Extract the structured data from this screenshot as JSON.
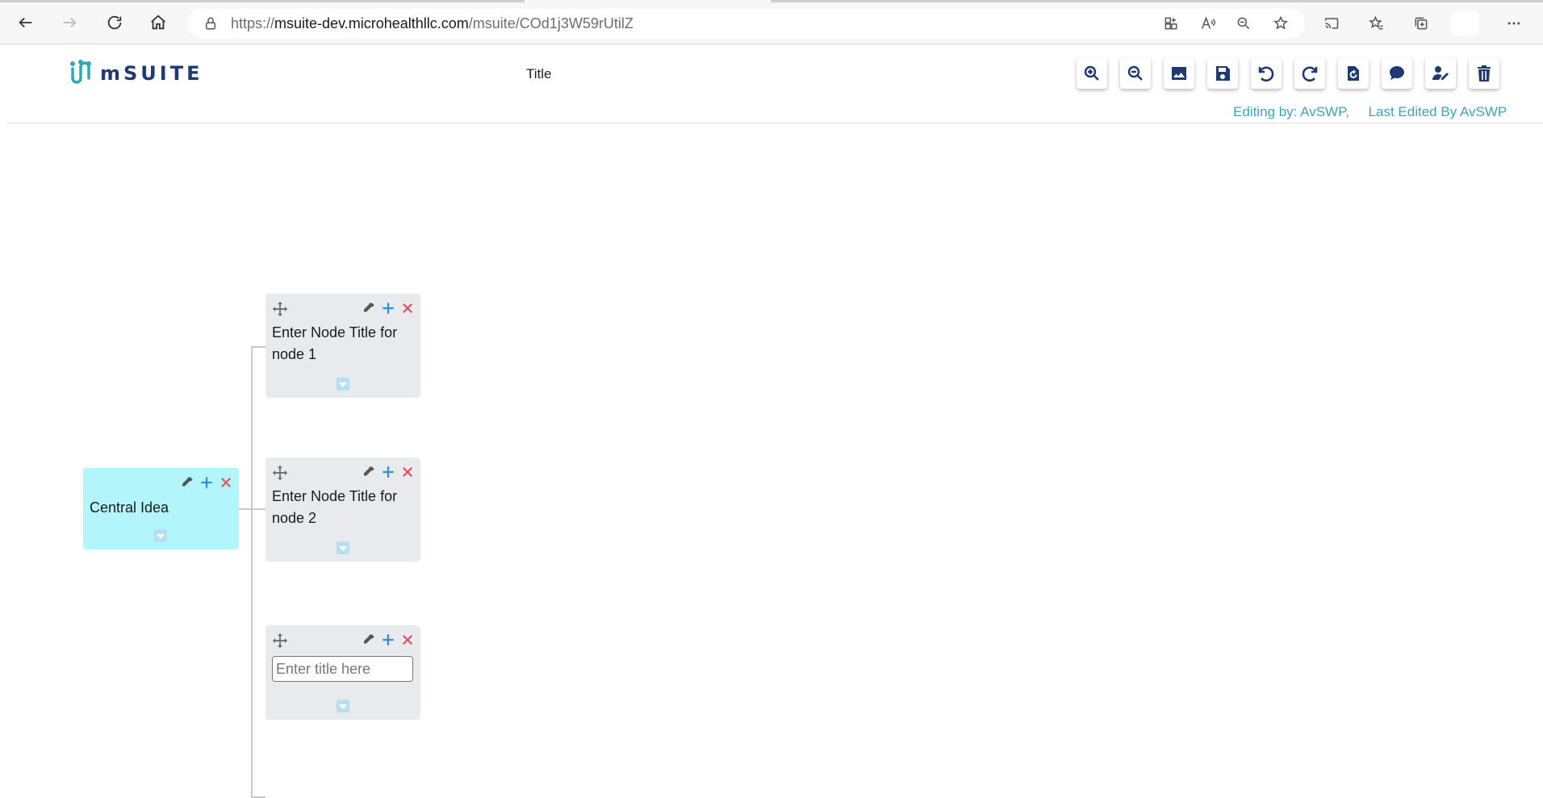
{
  "browser": {
    "url_prefix": "https://",
    "url_domain": "msuite-dev.microhealthllc.com",
    "url_path": "/msuite/COd1j3W59rUtilZ"
  },
  "app": {
    "logo_text": "mSUITE",
    "title": "Title",
    "editing_info": "Editing by: AvSWP,     Last Edited By AvSWP",
    "brand_color": "#1e3a70",
    "accent_color": "#3fa3c0"
  },
  "toolbar": [
    {
      "icon": "zoom-in-icon"
    },
    {
      "icon": "zoom-out-icon"
    },
    {
      "icon": "image-icon"
    },
    {
      "icon": "save-icon"
    },
    {
      "icon": "undo-icon"
    },
    {
      "icon": "redo-icon"
    },
    {
      "icon": "reset-icon"
    },
    {
      "icon": "comment-icon"
    },
    {
      "icon": "edit-user-icon"
    },
    {
      "icon": "trash-icon"
    }
  ],
  "mindmap": {
    "central": {
      "title": "Central Idea",
      "color": "#b2f6fc"
    },
    "nodes": [
      {
        "title": "Enter Node Title for node 1"
      },
      {
        "title": "Enter Node Title for node 2"
      },
      {
        "title": "",
        "input_placeholder": "Enter title here"
      }
    ]
  }
}
